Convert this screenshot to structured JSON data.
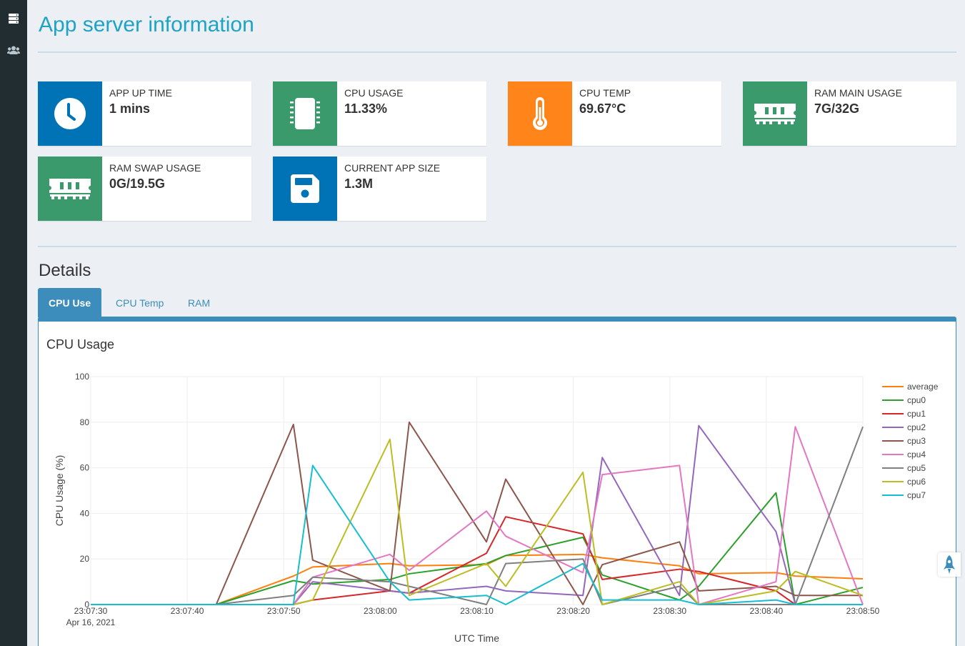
{
  "sidebar": {
    "items": [
      {
        "icon": "server-icon",
        "active": true
      },
      {
        "icon": "users-icon",
        "active": false
      }
    ]
  },
  "header": {
    "title": "App server information"
  },
  "info_boxes": [
    {
      "label": "APP UP TIME",
      "value": "1 mins",
      "icon": "clock-icon",
      "color": "#0073b7"
    },
    {
      "label": "CPU USAGE",
      "value": "11.33%",
      "icon": "cpu-chip-icon",
      "color": "#3a9a6c"
    },
    {
      "label": "CPU TEMP",
      "value": "69.67°C",
      "icon": "thermometer-icon",
      "color": "#ff851b"
    },
    {
      "label": "RAM MAIN USAGE",
      "value": "7G/32G",
      "icon": "memory-icon",
      "color": "#3a9a6c"
    },
    {
      "label": "RAM SWAP USAGE",
      "value": "0G/19.5G",
      "icon": "memory-icon",
      "color": "#3a9a6c"
    },
    {
      "label": "CURRENT APP SIZE",
      "value": "1.3M",
      "icon": "floppy-disk-icon",
      "color": "#0073b7"
    }
  ],
  "details": {
    "title": "Details",
    "tabs": [
      {
        "label": "CPU Use",
        "active": true
      },
      {
        "label": "CPU Temp",
        "active": false
      },
      {
        "label": "RAM",
        "active": false
      }
    ],
    "panel_title": "CPU Usage"
  },
  "chart_data": {
    "type": "line",
    "xlabel": "UTC Time",
    "ylabel": "CPU Usage (%)",
    "ylim": [
      0,
      100
    ],
    "xlim": [
      "23:07:30",
      "23:08:50"
    ],
    "x_ticks": [
      "23:07:30",
      "23:07:40",
      "23:07:50",
      "23:08:00",
      "23:08:10",
      "23:08:20",
      "23:08:30",
      "23:08:40",
      "23:08:50"
    ],
    "x_date_label": "Apr 16, 2021",
    "y_ticks": [
      0,
      20,
      40,
      60,
      80,
      100
    ],
    "legend_position": "right",
    "grid": true,
    "x": [
      "23:07:30",
      "23:07:43",
      "23:07:51",
      "23:07:53",
      "23:08:01",
      "23:08:03",
      "23:08:11",
      "23:08:13",
      "23:08:21",
      "23:08:23",
      "23:08:31",
      "23:08:33",
      "23:08:41",
      "23:08:43",
      "23:08:50"
    ],
    "series": [
      {
        "name": "average",
        "color": "#ff7f0e",
        "values": [
          0,
          0,
          12.5,
          16.5,
          18,
          17,
          17.5,
          21.5,
          22,
          20.5,
          17,
          13.5,
          14,
          12.5,
          11.3
        ]
      },
      {
        "name": "cpu0",
        "color": "#2ca02c",
        "values": [
          0,
          0,
          10.5,
          9,
          11,
          13.5,
          18,
          21.5,
          29.5,
          13,
          2,
          8,
          49,
          0,
          7.5
        ]
      },
      {
        "name": "cpu1",
        "color": "#d62728",
        "values": [
          0,
          0,
          0,
          2,
          6,
          5,
          22.5,
          38.5,
          31,
          11,
          15.5,
          14.5,
          6,
          0,
          0
        ]
      },
      {
        "name": "cpu2",
        "color": "#9467bd",
        "values": [
          0,
          0,
          0,
          10,
          6,
          5,
          8,
          6,
          4,
          64.5,
          4,
          78.5,
          32,
          0,
          0
        ]
      },
      {
        "name": "cpu3",
        "color": "#8c564b",
        "values": [
          0,
          0,
          79,
          19.5,
          6,
          80,
          27.5,
          55,
          0,
          17.5,
          27.5,
          6,
          8,
          4,
          4
        ]
      },
      {
        "name": "cpu4",
        "color": "#e377c2",
        "values": [
          0,
          0,
          0,
          12,
          22,
          15,
          41,
          30,
          14,
          57,
          61,
          0,
          10,
          78,
          0
        ]
      },
      {
        "name": "cpu5",
        "color": "#7f7f7f",
        "values": [
          0,
          0,
          4,
          12,
          10,
          8,
          0,
          18,
          20,
          0,
          8,
          0,
          0,
          0,
          78
        ]
      },
      {
        "name": "cpu6",
        "color": "#bcbd22",
        "values": [
          0,
          0,
          0,
          2,
          72.5,
          4,
          18,
          8,
          58,
          0,
          10,
          0,
          6,
          14.5,
          4
        ]
      },
      {
        "name": "cpu7",
        "color": "#17becf",
        "values": [
          0,
          0,
          0,
          61,
          10,
          2,
          4,
          0,
          18,
          2,
          2,
          0,
          2,
          0,
          0
        ]
      }
    ]
  }
}
